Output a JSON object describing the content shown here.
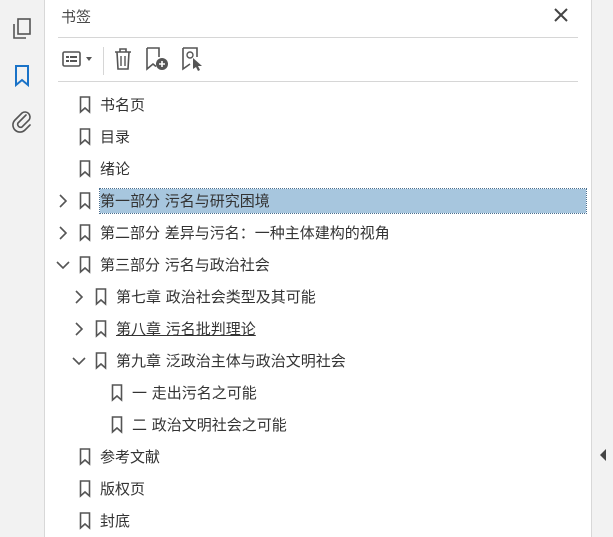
{
  "panel": {
    "title": "书签"
  },
  "rail": {
    "items": [
      {
        "icon": "pages-icon"
      },
      {
        "icon": "bookmark-icon",
        "active": true
      },
      {
        "icon": "attachment-icon"
      }
    ]
  },
  "toolbar": {
    "items": [
      {
        "icon": "options-menu-icon"
      },
      {
        "icon": "delete-icon"
      },
      {
        "icon": "new-bookmark-icon"
      },
      {
        "icon": "bookmark-from-selection-icon"
      }
    ]
  },
  "tree": {
    "items": [
      {
        "label": "书名页",
        "level": 0,
        "expander": "none"
      },
      {
        "label": "目录",
        "level": 0,
        "expander": "none"
      },
      {
        "label": "绪论",
        "level": 0,
        "expander": "none"
      },
      {
        "label": "第一部分 污名与研究困境",
        "level": 0,
        "expander": "collapsed",
        "selected": true
      },
      {
        "label": "第二部分 差异与污名：一种主体建构的视角",
        "level": 0,
        "expander": "collapsed"
      },
      {
        "label": "第三部分 污名与政治社会",
        "level": 0,
        "expander": "expanded"
      },
      {
        "label": "第七章 政治社会类型及其可能",
        "level": 1,
        "expander": "collapsed"
      },
      {
        "label": "第八章 污名批判理论",
        "level": 1,
        "expander": "collapsed",
        "underline": true
      },
      {
        "label": "第九章 泛政治主体与政治文明社会",
        "level": 1,
        "expander": "expanded"
      },
      {
        "label": "一 走出污名之可能",
        "level": 2,
        "expander": "none"
      },
      {
        "label": "二 政治文明社会之可能",
        "level": 2,
        "expander": "none"
      },
      {
        "label": "参考文献",
        "level": 0,
        "expander": "none"
      },
      {
        "label": "版权页",
        "level": 0,
        "expander": "none"
      },
      {
        "label": "封底",
        "level": 0,
        "expander": "none"
      }
    ]
  },
  "colors": {
    "selection": "#a7c6de",
    "active_icon": "#1a73c8",
    "icon": "#555555"
  }
}
